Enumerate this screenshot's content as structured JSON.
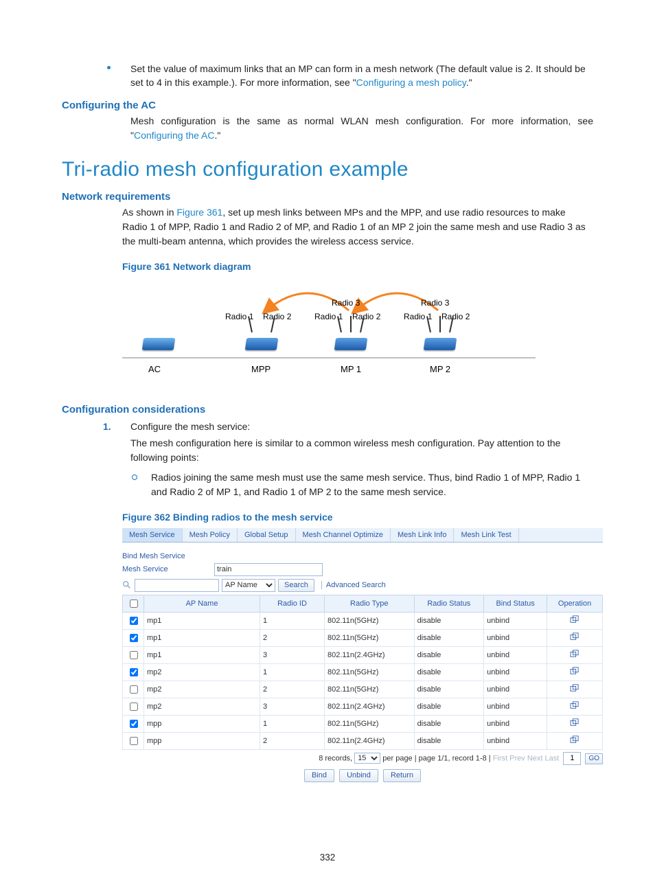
{
  "intro": {
    "bullet_pref": "Set the value of maximum links that an MP can form in a mesh network (The default value is 2. It should be set to 4 in this example.). For more information, see \"",
    "bullet_link": "Configuring a mesh policy",
    "bullet_post": ".\""
  },
  "sec1": {
    "title": "Configuring the AC",
    "p_pref": "Mesh configuration is the same as normal WLAN mesh configuration. For more information, see \"",
    "p_link": "Configuring the AC",
    "p_post": ".\""
  },
  "h1": "Tri-radio mesh configuration example",
  "sec2": {
    "title": "Network requirements",
    "p_pref": "As shown in ",
    "p_link": "Figure 361",
    "p_rest": ", set up mesh links between MPs and the MPP, and use radio resources to make Radio 1 of MPP, Radio 1 and Radio 2 of MP, and Radio 1 of an MP 2 join the same mesh and use Radio 3 as the multi-beam antenna, which provides the wireless access service."
  },
  "fig1_caption": "Figure 361 Network diagram",
  "diagram": {
    "nodes": {
      "ac": "AC",
      "mpp": "MPP",
      "mp1": "MP 1",
      "mp2": "MP 2"
    },
    "labels": {
      "r1": "Radio 1",
      "r2": "Radio 2",
      "r3": "Radio 3"
    }
  },
  "sec3": {
    "title": "Configuration considerations",
    "step1_num": "1.",
    "step1": "Configure the mesh service:",
    "step1_note": "The mesh configuration here is similar to a common wireless mesh configuration. Pay attention to the following points:",
    "sub1": "Radios joining the same mesh must use the same mesh service. Thus, bind Radio 1 of MPP, Radio 1 and Radio 2 of MP 1, and Radio 1 of MP 2 to the same mesh service."
  },
  "fig2_caption": "Figure 362 Binding radios to the mesh service",
  "ui": {
    "tabs": [
      "Mesh Service",
      "Mesh Policy",
      "Global Setup",
      "Mesh Channel Optimize",
      "Mesh Link Info",
      "Mesh Link Test"
    ],
    "active_tab": 0,
    "section_title": "Bind Mesh Service",
    "mesh_service_label": "Mesh Service",
    "mesh_service_value": "train",
    "filter_placeholder": "",
    "filter_field": "AP Name",
    "search_btn": "Search",
    "advanced": "Advanced Search",
    "columns": [
      "",
      "AP Name",
      "Radio ID",
      "Radio Type",
      "Radio Status",
      "Bind Status",
      "Operation"
    ],
    "rows": [
      {
        "checked": true,
        "ap": "mp1",
        "rid": "1",
        "rtype": "802.11n(5GHz)",
        "rstatus": "disable",
        "bstatus": "unbind"
      },
      {
        "checked": true,
        "ap": "mp1",
        "rid": "2",
        "rtype": "802.11n(5GHz)",
        "rstatus": "disable",
        "bstatus": "unbind"
      },
      {
        "checked": false,
        "ap": "mp1",
        "rid": "3",
        "rtype": "802.11n(2.4GHz)",
        "rstatus": "disable",
        "bstatus": "unbind"
      },
      {
        "checked": true,
        "ap": "mp2",
        "rid": "1",
        "rtype": "802.11n(5GHz)",
        "rstatus": "disable",
        "bstatus": "unbind"
      },
      {
        "checked": false,
        "ap": "mp2",
        "rid": "2",
        "rtype": "802.11n(5GHz)",
        "rstatus": "disable",
        "bstatus": "unbind"
      },
      {
        "checked": false,
        "ap": "mp2",
        "rid": "3",
        "rtype": "802.11n(2.4GHz)",
        "rstatus": "disable",
        "bstatus": "unbind"
      },
      {
        "checked": true,
        "ap": "mpp",
        "rid": "1",
        "rtype": "802.11n(5GHz)",
        "rstatus": "disable",
        "bstatus": "unbind"
      },
      {
        "checked": false,
        "ap": "mpp",
        "rid": "2",
        "rtype": "802.11n(2.4GHz)",
        "rstatus": "disable",
        "bstatus": "unbind"
      }
    ],
    "pager": {
      "records_pref": "8 records,",
      "per_page_value": "15",
      "middle_text": "per page | page 1/1, record 1-8 |",
      "first": "First",
      "prev": "Prev",
      "next": "Next",
      "last": "Last",
      "page_input": "1",
      "go": "GO"
    },
    "actions": {
      "bind": "Bind",
      "unbind": "Unbind",
      "return": "Return"
    }
  },
  "page_number": "332"
}
